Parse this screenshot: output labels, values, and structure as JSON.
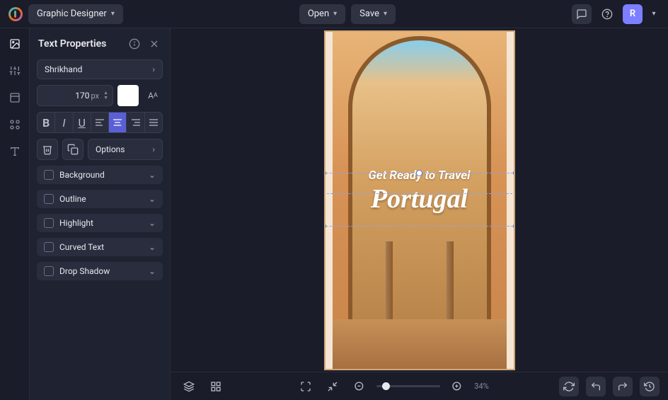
{
  "topbar": {
    "app_mode": "Graphic Designer",
    "open": "Open",
    "save": "Save",
    "avatar": "R"
  },
  "panel": {
    "title": "Text Properties",
    "font": "Shrikhand",
    "size": "170",
    "size_unit": "px",
    "options": "Options",
    "accordions": {
      "background": "Background",
      "outline": "Outline",
      "highlight": "Highlight",
      "curved": "Curved Text",
      "shadow": "Drop Shadow"
    }
  },
  "canvas": {
    "subtitle": "Get Ready to Travel",
    "title": "Portugal"
  },
  "bottom": {
    "zoom": "34%"
  }
}
